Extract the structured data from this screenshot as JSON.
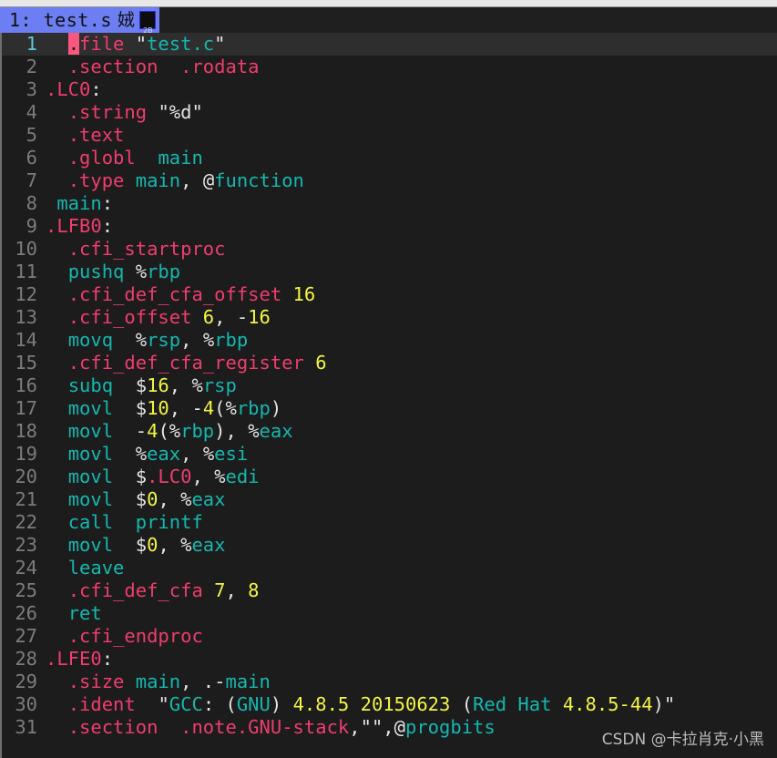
{
  "window": {
    "title_strip_color": "#e8e8e6"
  },
  "tabline": {
    "tab_label": "1: test.s",
    "tab_cjk": "娀",
    "tofu_top": "2B",
    "tofu_bottom": "80",
    "tab_bg": "#6c7ef2"
  },
  "editor": {
    "filler_marker": "~",
    "colors": {
      "background": "#1c1c1c",
      "cursorline": "#2e2e2e",
      "directive": "#ef3d6e",
      "identifier": "#13b8b0",
      "number": "#f3f53f",
      "punctuation": "#e4e4e4",
      "linenr": "#7c7c7c",
      "cursorlinenr": "#5ec8d8",
      "cursor": "#f9577e",
      "tilde": "#4f6ea8"
    },
    "lines": [
      {
        "n": "1",
        "current": true,
        "tokens": [
          {
            "t": "  ",
            "c": "punc"
          },
          {
            "t": ".",
            "c": "dir",
            "cursor": true
          },
          {
            "t": "file",
            "c": "dir"
          },
          {
            "t": " ",
            "c": "punc"
          },
          {
            "t": "\"",
            "c": "punc"
          },
          {
            "t": "test.c",
            "c": "str"
          },
          {
            "t": "\"",
            "c": "punc"
          }
        ]
      },
      {
        "n": "2",
        "current": false,
        "tokens": [
          {
            "t": "  ",
            "c": "punc"
          },
          {
            "t": ".section",
            "c": "dir"
          },
          {
            "t": "  ",
            "c": "punc"
          },
          {
            "t": ".rodata",
            "c": "dir"
          }
        ]
      },
      {
        "n": "3",
        "current": false,
        "tokens": [
          {
            "t": ".LC0",
            "c": "dir"
          },
          {
            "t": ":",
            "c": "punc"
          }
        ]
      },
      {
        "n": "4",
        "current": false,
        "tokens": [
          {
            "t": "  ",
            "c": "punc"
          },
          {
            "t": ".string",
            "c": "dir"
          },
          {
            "t": " ",
            "c": "punc"
          },
          {
            "t": "\"",
            "c": "punc"
          },
          {
            "t": "%d",
            "c": "punc"
          },
          {
            "t": "\"",
            "c": "punc"
          }
        ]
      },
      {
        "n": "5",
        "current": false,
        "tokens": [
          {
            "t": "  ",
            "c": "punc"
          },
          {
            "t": ".text",
            "c": "dir"
          }
        ]
      },
      {
        "n": "6",
        "current": false,
        "tokens": [
          {
            "t": "  ",
            "c": "punc"
          },
          {
            "t": ".globl",
            "c": "dir"
          },
          {
            "t": "  ",
            "c": "punc"
          },
          {
            "t": "main",
            "c": "id"
          }
        ]
      },
      {
        "n": "7",
        "current": false,
        "tokens": [
          {
            "t": "  ",
            "c": "punc"
          },
          {
            "t": ".type",
            "c": "dir"
          },
          {
            "t": " ",
            "c": "punc"
          },
          {
            "t": "main",
            "c": "id"
          },
          {
            "t": ", ",
            "c": "punc"
          },
          {
            "t": "@",
            "c": "punc"
          },
          {
            "t": "function",
            "c": "id"
          }
        ]
      },
      {
        "n": "8",
        "current": false,
        "tokens": [
          {
            "t": " ",
            "c": "punc"
          },
          {
            "t": "main",
            "c": "id"
          },
          {
            "t": ":",
            "c": "punc"
          }
        ]
      },
      {
        "n": "9",
        "current": false,
        "tokens": [
          {
            "t": ".LFB0",
            "c": "dir"
          },
          {
            "t": ":",
            "c": "punc"
          }
        ]
      },
      {
        "n": "10",
        "current": false,
        "tokens": [
          {
            "t": "  ",
            "c": "punc"
          },
          {
            "t": ".cfi_startproc",
            "c": "dir"
          }
        ]
      },
      {
        "n": "11",
        "current": false,
        "tokens": [
          {
            "t": "  ",
            "c": "punc"
          },
          {
            "t": "pushq",
            "c": "id"
          },
          {
            "t": " ",
            "c": "punc"
          },
          {
            "t": "%",
            "c": "punc"
          },
          {
            "t": "rbp",
            "c": "id"
          }
        ]
      },
      {
        "n": "12",
        "current": false,
        "tokens": [
          {
            "t": "  ",
            "c": "punc"
          },
          {
            "t": ".cfi_def_cfa_offset",
            "c": "dir"
          },
          {
            "t": " ",
            "c": "punc"
          },
          {
            "t": "16",
            "c": "num"
          }
        ]
      },
      {
        "n": "13",
        "current": false,
        "tokens": [
          {
            "t": "  ",
            "c": "punc"
          },
          {
            "t": ".cfi_offset",
            "c": "dir"
          },
          {
            "t": " ",
            "c": "punc"
          },
          {
            "t": "6",
            "c": "num"
          },
          {
            "t": ", -",
            "c": "punc"
          },
          {
            "t": "16",
            "c": "num"
          }
        ]
      },
      {
        "n": "14",
        "current": false,
        "tokens": [
          {
            "t": "  ",
            "c": "punc"
          },
          {
            "t": "movq",
            "c": "id"
          },
          {
            "t": "  ",
            "c": "punc"
          },
          {
            "t": "%",
            "c": "punc"
          },
          {
            "t": "rsp",
            "c": "id"
          },
          {
            "t": ", ",
            "c": "punc"
          },
          {
            "t": "%",
            "c": "punc"
          },
          {
            "t": "rbp",
            "c": "id"
          }
        ]
      },
      {
        "n": "15",
        "current": false,
        "tokens": [
          {
            "t": "  ",
            "c": "punc"
          },
          {
            "t": ".cfi_def_cfa_register",
            "c": "dir"
          },
          {
            "t": " ",
            "c": "punc"
          },
          {
            "t": "6",
            "c": "num"
          }
        ]
      },
      {
        "n": "16",
        "current": false,
        "tokens": [
          {
            "t": "  ",
            "c": "punc"
          },
          {
            "t": "subq",
            "c": "id"
          },
          {
            "t": "  ",
            "c": "punc"
          },
          {
            "t": "$",
            "c": "punc"
          },
          {
            "t": "16",
            "c": "num"
          },
          {
            "t": ", ",
            "c": "punc"
          },
          {
            "t": "%",
            "c": "punc"
          },
          {
            "t": "rsp",
            "c": "id"
          }
        ]
      },
      {
        "n": "17",
        "current": false,
        "tokens": [
          {
            "t": "  ",
            "c": "punc"
          },
          {
            "t": "movl",
            "c": "id"
          },
          {
            "t": "  ",
            "c": "punc"
          },
          {
            "t": "$",
            "c": "punc"
          },
          {
            "t": "10",
            "c": "num"
          },
          {
            "t": ", -",
            "c": "punc"
          },
          {
            "t": "4",
            "c": "num"
          },
          {
            "t": "(",
            "c": "punc"
          },
          {
            "t": "%",
            "c": "punc"
          },
          {
            "t": "rbp",
            "c": "id"
          },
          {
            "t": ")",
            "c": "punc"
          }
        ]
      },
      {
        "n": "18",
        "current": false,
        "tokens": [
          {
            "t": "  ",
            "c": "punc"
          },
          {
            "t": "movl",
            "c": "id"
          },
          {
            "t": "  -",
            "c": "punc"
          },
          {
            "t": "4",
            "c": "num"
          },
          {
            "t": "(",
            "c": "punc"
          },
          {
            "t": "%",
            "c": "punc"
          },
          {
            "t": "rbp",
            "c": "id"
          },
          {
            "t": "), ",
            "c": "punc"
          },
          {
            "t": "%",
            "c": "punc"
          },
          {
            "t": "eax",
            "c": "id"
          }
        ]
      },
      {
        "n": "19",
        "current": false,
        "tokens": [
          {
            "t": "  ",
            "c": "punc"
          },
          {
            "t": "movl",
            "c": "id"
          },
          {
            "t": "  ",
            "c": "punc"
          },
          {
            "t": "%",
            "c": "punc"
          },
          {
            "t": "eax",
            "c": "id"
          },
          {
            "t": ", ",
            "c": "punc"
          },
          {
            "t": "%",
            "c": "punc"
          },
          {
            "t": "esi",
            "c": "id"
          }
        ]
      },
      {
        "n": "20",
        "current": false,
        "tokens": [
          {
            "t": "  ",
            "c": "punc"
          },
          {
            "t": "movl",
            "c": "id"
          },
          {
            "t": "  ",
            "c": "punc"
          },
          {
            "t": "$",
            "c": "punc"
          },
          {
            "t": ".LC0",
            "c": "dir"
          },
          {
            "t": ", ",
            "c": "punc"
          },
          {
            "t": "%",
            "c": "punc"
          },
          {
            "t": "edi",
            "c": "id"
          }
        ]
      },
      {
        "n": "21",
        "current": false,
        "tokens": [
          {
            "t": "  ",
            "c": "punc"
          },
          {
            "t": "movl",
            "c": "id"
          },
          {
            "t": "  ",
            "c": "punc"
          },
          {
            "t": "$",
            "c": "punc"
          },
          {
            "t": "0",
            "c": "num"
          },
          {
            "t": ", ",
            "c": "punc"
          },
          {
            "t": "%",
            "c": "punc"
          },
          {
            "t": "eax",
            "c": "id"
          }
        ]
      },
      {
        "n": "22",
        "current": false,
        "tokens": [
          {
            "t": "  ",
            "c": "punc"
          },
          {
            "t": "call",
            "c": "id"
          },
          {
            "t": "  ",
            "c": "punc"
          },
          {
            "t": "printf",
            "c": "id"
          }
        ]
      },
      {
        "n": "23",
        "current": false,
        "tokens": [
          {
            "t": "  ",
            "c": "punc"
          },
          {
            "t": "movl",
            "c": "id"
          },
          {
            "t": "  ",
            "c": "punc"
          },
          {
            "t": "$",
            "c": "punc"
          },
          {
            "t": "0",
            "c": "num"
          },
          {
            "t": ", ",
            "c": "punc"
          },
          {
            "t": "%",
            "c": "punc"
          },
          {
            "t": "eax",
            "c": "id"
          }
        ]
      },
      {
        "n": "24",
        "current": false,
        "tokens": [
          {
            "t": "  ",
            "c": "punc"
          },
          {
            "t": "leave",
            "c": "id"
          }
        ]
      },
      {
        "n": "25",
        "current": false,
        "tokens": [
          {
            "t": "  ",
            "c": "punc"
          },
          {
            "t": ".cfi_def_cfa",
            "c": "dir"
          },
          {
            "t": " ",
            "c": "punc"
          },
          {
            "t": "7",
            "c": "num"
          },
          {
            "t": ", ",
            "c": "punc"
          },
          {
            "t": "8",
            "c": "num"
          }
        ]
      },
      {
        "n": "26",
        "current": false,
        "tokens": [
          {
            "t": "  ",
            "c": "punc"
          },
          {
            "t": "ret",
            "c": "id"
          }
        ]
      },
      {
        "n": "27",
        "current": false,
        "tokens": [
          {
            "t": "  ",
            "c": "punc"
          },
          {
            "t": ".cfi_endproc",
            "c": "dir"
          }
        ]
      },
      {
        "n": "28",
        "current": false,
        "tokens": [
          {
            "t": ".LFE0",
            "c": "dir"
          },
          {
            "t": ":",
            "c": "punc"
          }
        ]
      },
      {
        "n": "29",
        "current": false,
        "tokens": [
          {
            "t": "  ",
            "c": "punc"
          },
          {
            "t": ".size",
            "c": "dir"
          },
          {
            "t": " ",
            "c": "punc"
          },
          {
            "t": "main",
            "c": "id"
          },
          {
            "t": ", .-",
            "c": "punc"
          },
          {
            "t": "main",
            "c": "id"
          }
        ]
      },
      {
        "n": "30",
        "current": false,
        "tokens": [
          {
            "t": "  ",
            "c": "punc"
          },
          {
            "t": ".ident",
            "c": "dir"
          },
          {
            "t": "  ",
            "c": "punc"
          },
          {
            "t": "\"",
            "c": "punc"
          },
          {
            "t": "GCC",
            "c": "str"
          },
          {
            "t": ": (",
            "c": "punc"
          },
          {
            "t": "GNU",
            "c": "str"
          },
          {
            "t": ") ",
            "c": "punc"
          },
          {
            "t": "4.8.5",
            "c": "num"
          },
          {
            "t": " ",
            "c": "punc"
          },
          {
            "t": "20150623",
            "c": "num"
          },
          {
            "t": " (",
            "c": "punc"
          },
          {
            "t": "Red Hat",
            "c": "str"
          },
          {
            "t": " ",
            "c": "punc"
          },
          {
            "t": "4.8.5-44",
            "c": "num"
          },
          {
            "t": ")",
            "c": "punc"
          },
          {
            "t": "\"",
            "c": "punc"
          }
        ]
      },
      {
        "n": "31",
        "current": false,
        "tokens": [
          {
            "t": "  ",
            "c": "punc"
          },
          {
            "t": ".section",
            "c": "dir"
          },
          {
            "t": "  ",
            "c": "punc"
          },
          {
            "t": ".note.GNU-stack",
            "c": "dir"
          },
          {
            "t": ",",
            "c": "punc"
          },
          {
            "t": "\"\"",
            "c": "punc"
          },
          {
            "t": ",",
            "c": "punc"
          },
          {
            "t": "@",
            "c": "punc"
          },
          {
            "t": "progbits",
            "c": "id"
          }
        ]
      }
    ]
  },
  "watermark": {
    "text": "CSDN @卡拉肖克·小黑"
  }
}
